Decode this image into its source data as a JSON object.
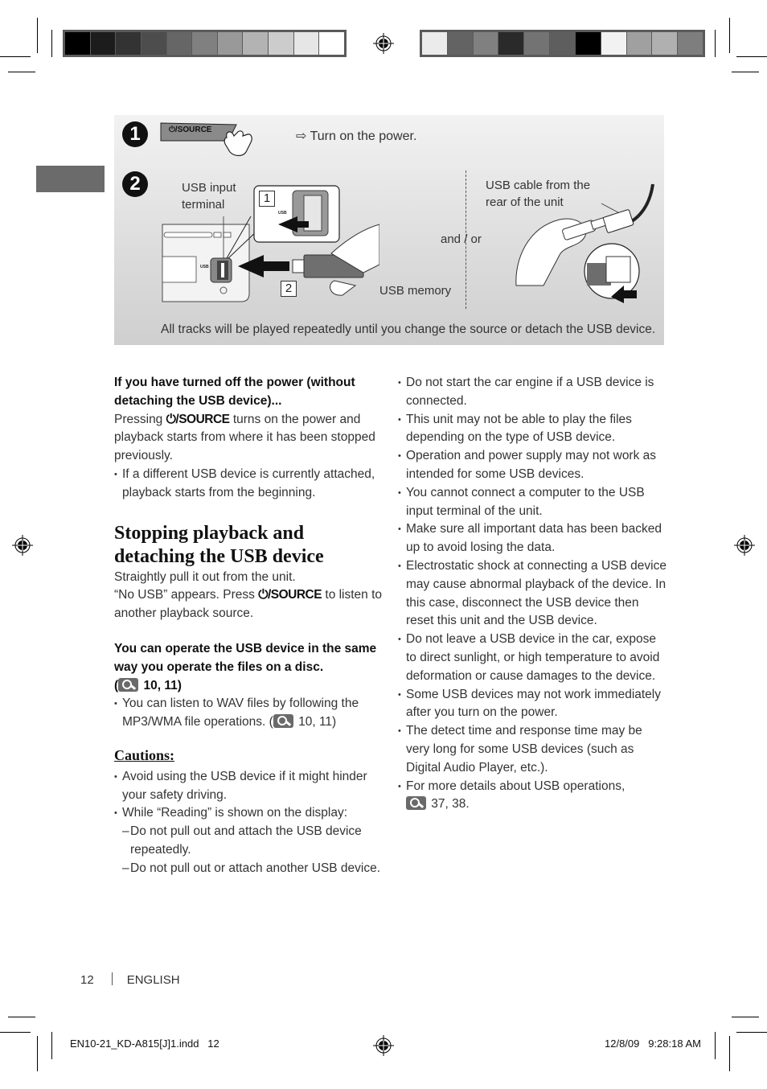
{
  "figure": {
    "step1": {
      "number": "1",
      "button_label": "⏻/SOURCE",
      "instruction": "⇨ Turn on the power."
    },
    "step2": {
      "number": "2",
      "usb_input_terminal_label": "USB input terminal",
      "usb_small_label": "USB",
      "sub_step_1": "1",
      "sub_step_2": "2",
      "usb_memory_label": "USB memory",
      "and_or_label": "and / or",
      "usb_cable_label": "USB cable from the rear of the unit"
    },
    "caption": "All tracks will be played repeatedly until you change the source or detach the USB device."
  },
  "left_column": {
    "power_off_heading": "If you have turned off the power (without detaching the USB device)...",
    "power_off_text_pre": "Pressing ",
    "source_button": "⏻/SOURCE",
    "power_off_text_post": " turns on the power and playback starts from where it has been stopped previously.",
    "power_off_bullet": "If a different USB device is currently attached, playback starts from the beginning.",
    "stopping_heading": "Stopping playback and detaching the USB device",
    "stopping_line1": "Straightly pull it out from the unit.",
    "stopping_line2_pre": "“No USB” appears. Press ",
    "stopping_line2_post": " to listen to another playback source.",
    "operate_heading": "You can operate the USB device in the same way you operate the files on a disc.",
    "operate_ref_open": "(",
    "operate_ref_pages": " 10, 11)",
    "wav_bullet_pre": "You can listen to WAV files by following the MP3/WMA file operations. (",
    "wav_bullet_pages": " 10, 11)",
    "cautions_heading": "Cautions:",
    "cautions": [
      "Avoid using the USB device if it might hinder your safety driving.",
      "While “Reading” is shown on the display:"
    ],
    "reading_subitems": [
      "Do not pull out and attach the USB device repeatedly.",
      "Do not pull out or attach another USB device."
    ],
    "dash_mark": "–"
  },
  "right_column": {
    "bullets": [
      "Do not start the car engine if a USB device is connected.",
      "This unit may not be able to play the files depending on the type of USB device.",
      "Operation and power supply may not work as intended for some USB devices.",
      "You cannot connect a computer to the USB input terminal of the unit.",
      "Make sure all important data has been backed up to avoid losing the data.",
      "Electrostatic shock at connecting a USB device may cause abnormal playback of the device. In this case, disconnect the USB device then reset this unit and the USB device.",
      "Do not leave a USB device in the car, expose to direct sunlight, or high temperature to avoid deformation or cause damages to the device.",
      "Some USB devices may not work immediately after you turn on the power.",
      "The detect time and response time may be very long for some USB devices (such as Digital Audio Player, etc.)."
    ],
    "last_bullet_pre": "For more details about USB operations,",
    "last_bullet_pages": " 37, 38."
  },
  "footer": {
    "page_number": "12",
    "language": "ENGLISH",
    "slug_file": "EN10-21_KD-A815[J]1.indd   12",
    "slug_date": "12/8/09   9:28:18 AM"
  },
  "colors": {
    "left_colorbar": [
      "#000000",
      "#1c1c1c",
      "#333333",
      "#4d4d4d",
      "#666666",
      "#808080",
      "#999999",
      "#b3b3b3",
      "#cccccc",
      "#e6e6e6",
      "#ffffff"
    ],
    "right_colorbar": [
      "#ebebeb",
      "#636363",
      "#808080",
      "#2a2a2a",
      "#737373",
      "#5e5e5e",
      "#000000",
      "#f2f2f2",
      "#a0a0a0",
      "#b0b0b0",
      "#7e7e7e"
    ],
    "side_tab": "#6b6b6b"
  }
}
